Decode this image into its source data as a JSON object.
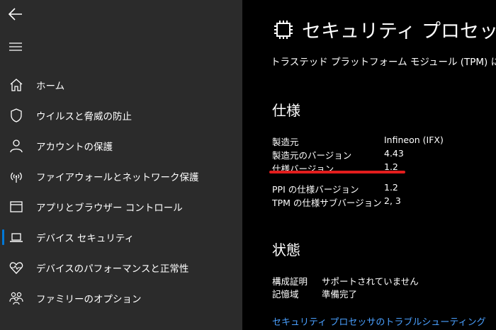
{
  "sidebar": {
    "items": [
      {
        "label": "ホーム",
        "icon": "home-icon"
      },
      {
        "label": "ウイルスと脅威の防止",
        "icon": "shield-icon"
      },
      {
        "label": "アカウントの保護",
        "icon": "person-icon"
      },
      {
        "label": "ファイアウォールとネットワーク保護",
        "icon": "wifi-icon"
      },
      {
        "label": "アプリとブラウザー コントロール",
        "icon": "app-window-icon"
      },
      {
        "label": "デバイス セキュリティ",
        "icon": "laptop-icon",
        "selected": true
      },
      {
        "label": "デバイスのパフォーマンスと正常性",
        "icon": "heart-icon"
      },
      {
        "label": "ファミリーのオプション",
        "icon": "family-icon"
      }
    ]
  },
  "main": {
    "title": "セキュリティ プロセッサの詳細",
    "subtitle": "トラステッド プラットフォーム モジュール (TPM) に関する情報",
    "spec_heading": "仕様",
    "specs": [
      {
        "key": "製造元",
        "value": "Infineon (IFX)"
      },
      {
        "key": "製造元のバージョン",
        "value": "4.43"
      },
      {
        "key": "仕様バージョン",
        "value": "1.2"
      },
      {
        "key": "PPI の仕様バージョン",
        "value": "1.2"
      },
      {
        "key": "TPM の仕様サブバージョン",
        "value": "2, 3"
      }
    ],
    "status_heading": "状態",
    "status": [
      {
        "key": "構成証明",
        "value": "サポートされていません"
      },
      {
        "key": "記憶域",
        "value": "準備完了"
      }
    ],
    "link": "セキュリティ プロセッサのトラブルシューティング"
  },
  "colors": {
    "sidebar_bg": "#2b2b2b",
    "main_bg": "#000000",
    "accent": "#0078d7",
    "highlight": "#e21d1d",
    "link": "#4aa0ff"
  }
}
